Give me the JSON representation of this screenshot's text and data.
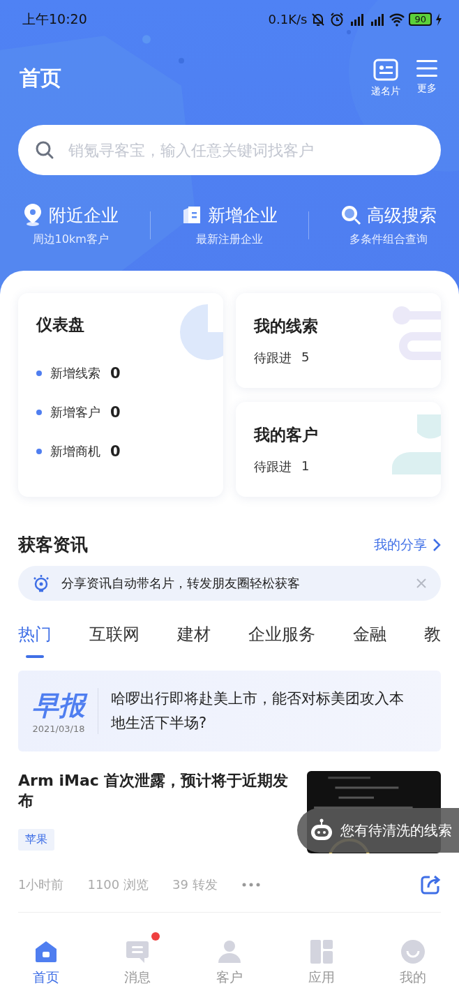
{
  "status_bar": {
    "time": "上午10:20",
    "speed": "0.1K/s",
    "battery": "90"
  },
  "header": {
    "title": "首页",
    "actions": [
      {
        "label": "递名片"
      },
      {
        "label": "更多"
      }
    ]
  },
  "search": {
    "placeholder": "销氪寻客宝，输入任意关键词找客户"
  },
  "quick_links": [
    {
      "title": "附近企业",
      "subtitle": "周边10km客户"
    },
    {
      "title": "新增企业",
      "subtitle": "最新注册企业"
    },
    {
      "title": "高级搜索",
      "subtitle": "多条件组合查询"
    }
  ],
  "dashboard": {
    "title": "仪表盘",
    "stats": [
      {
        "label": "新增线索",
        "value": "0"
      },
      {
        "label": "新增客户",
        "value": "0"
      },
      {
        "label": "新增商机",
        "value": "0"
      }
    ]
  },
  "side_cards": [
    {
      "title": "我的线索",
      "label": "待跟进",
      "value": "5"
    },
    {
      "title": "我的客户",
      "label": "待跟进",
      "value": "1"
    }
  ],
  "news": {
    "title": "获客资讯",
    "link": "我的分享",
    "notice": "分享资讯自动带名片，转发朋友圈轻松获客",
    "tabs": [
      {
        "label": "热门",
        "selected": true
      },
      {
        "label": "互联网",
        "selected": false
      },
      {
        "label": "建材",
        "selected": false
      },
      {
        "label": "企业服务",
        "selected": false
      },
      {
        "label": "金融",
        "selected": false
      },
      {
        "label": "教",
        "selected": false
      }
    ],
    "daily": {
      "badge": "早报",
      "date": "2021/03/18",
      "headline": "哈啰出行即将赴美上市，能否对标美团攻入本地生活下半场?"
    },
    "article": {
      "title": "Arm iMac 首次泄露，预计将于近期发布",
      "tag": "苹果",
      "time": "1小时前",
      "views": "1100 浏览",
      "shares": "39 转发"
    }
  },
  "floating_tip": "您有待清洗的线索",
  "tab_bar": [
    {
      "label": "首页",
      "selected": true,
      "badge": false
    },
    {
      "label": "消息",
      "selected": false,
      "badge": true
    },
    {
      "label": "客户",
      "selected": false,
      "badge": false
    },
    {
      "label": "应用",
      "selected": false,
      "badge": false
    },
    {
      "label": "我的",
      "selected": false,
      "badge": false
    }
  ]
}
